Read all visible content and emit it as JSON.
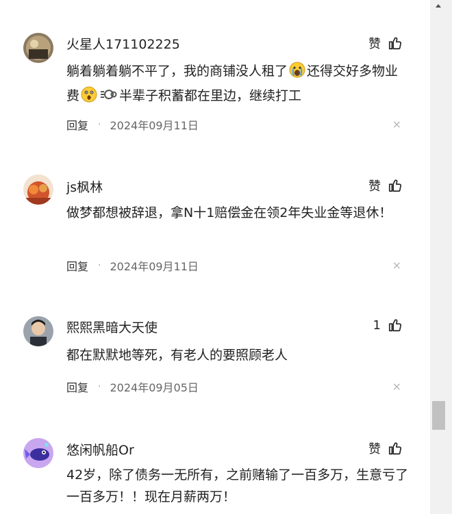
{
  "comments": [
    {
      "username": "火星人171102225",
      "like_label": "赞",
      "text_a": "躺着躺着躺不平了，我的商铺没人租了",
      "text_b": "还得交好多物业费",
      "text_c": "半辈子积蓄都在里边，继续打工",
      "emoji_a": "crying-face",
      "emoji_b": "astonished-face",
      "emoji_c": "dash-puff",
      "reply_label": "回复",
      "separator": "·",
      "date": "2024年09月11日",
      "close": "×"
    },
    {
      "username": "js枫林",
      "like_label": "赞",
      "text": "做梦都想被辞退，拿N十1赔偿金在领2年失业金等退休！",
      "reply_label": "回复",
      "separator": "·",
      "date": "2024年09月11日",
      "close": "×"
    },
    {
      "username": "熙熙黑暗大天使",
      "like_label": "1",
      "text": "都在默默地等死，有老人的要照顾老人",
      "reply_label": "回复",
      "separator": "·",
      "date": "2024年09月05日",
      "close": "×"
    },
    {
      "username": "悠闲帆船Or",
      "like_label": "赞",
      "text": "42岁，除了债务一无所有，之前赌输了一百多万，生意亏了一百多万！！现在月薪两万！"
    }
  ],
  "colors": {
    "text": "#222222",
    "meta": "#666666",
    "close": "#b5b5b5",
    "scrollbar_track": "#f1f1f1",
    "scrollbar_thumb": "#c1c1c1"
  },
  "icons": {
    "like": "thumbs-up-icon",
    "close": "close-icon"
  }
}
